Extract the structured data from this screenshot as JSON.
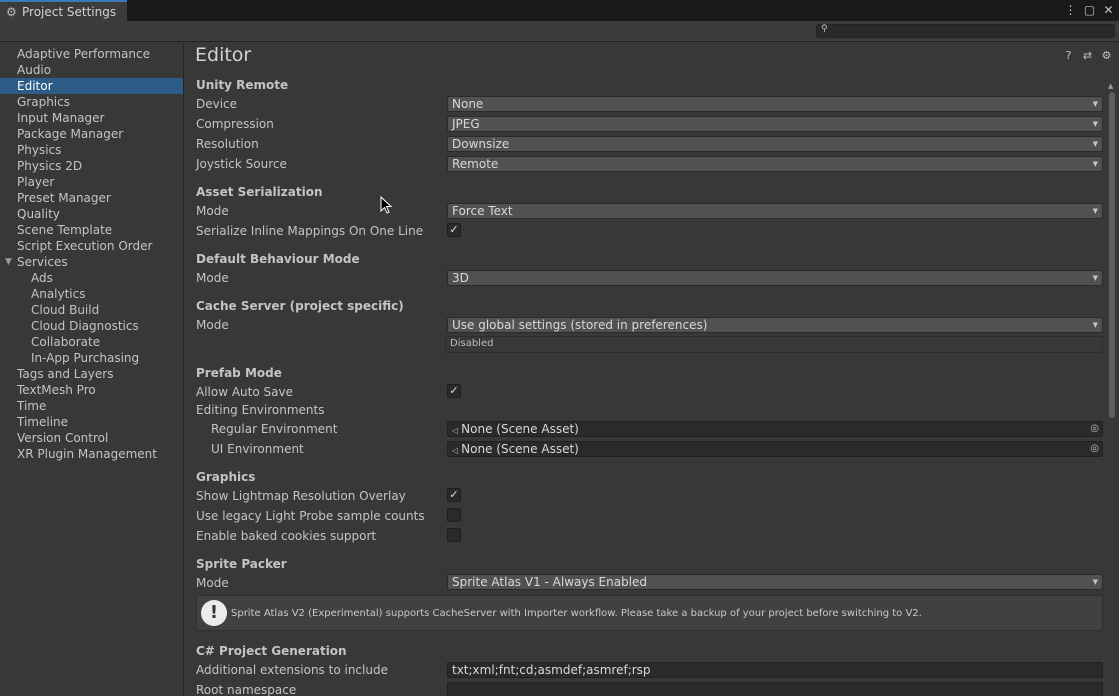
{
  "window": {
    "title": "Project Settings",
    "menu": "⋮",
    "maximize": "▢",
    "close": "✕"
  },
  "search": {
    "placeholder": ""
  },
  "sidebar": {
    "items": [
      {
        "label": "Adaptive Performance"
      },
      {
        "label": "Audio"
      },
      {
        "label": "Editor"
      },
      {
        "label": "Graphics"
      },
      {
        "label": "Input Manager"
      },
      {
        "label": "Package Manager"
      },
      {
        "label": "Physics"
      },
      {
        "label": "Physics 2D"
      },
      {
        "label": "Player"
      },
      {
        "label": "Preset Manager"
      },
      {
        "label": "Quality"
      },
      {
        "label": "Scene Template"
      },
      {
        "label": "Script Execution Order"
      },
      {
        "label": "Services"
      },
      {
        "label": "Ads"
      },
      {
        "label": "Analytics"
      },
      {
        "label": "Cloud Build"
      },
      {
        "label": "Cloud Diagnostics"
      },
      {
        "label": "Collaborate"
      },
      {
        "label": "In-App Purchasing"
      },
      {
        "label": "Tags and Layers"
      },
      {
        "label": "TextMesh Pro"
      },
      {
        "label": "Time"
      },
      {
        "label": "Timeline"
      },
      {
        "label": "Version Control"
      },
      {
        "label": "XR Plugin Management"
      }
    ],
    "selected": "Editor"
  },
  "main": {
    "title": "Editor",
    "unity_remote": {
      "header": "Unity Remote",
      "device_label": "Device",
      "device": "None",
      "compression_label": "Compression",
      "compression": "JPEG",
      "resolution_label": "Resolution",
      "resolution": "Downsize",
      "joystick_label": "Joystick Source",
      "joystick": "Remote"
    },
    "asset_serialization": {
      "header": "Asset Serialization",
      "mode_label": "Mode",
      "mode": "Force Text",
      "inline_label": "Serialize Inline Mappings On One Line",
      "inline_checked": true
    },
    "default_behaviour": {
      "header": "Default Behaviour Mode",
      "mode_label": "Mode",
      "mode": "3D"
    },
    "cache_server": {
      "header": "Cache Server (project specific)",
      "mode_label": "Mode",
      "mode": "Use global settings (stored in preferences)",
      "status": "Disabled"
    },
    "prefab_mode": {
      "header": "Prefab Mode",
      "autosave_label": "Allow Auto Save",
      "autosave_checked": true,
      "env_label": "Editing Environments",
      "regular_label": "Regular Environment",
      "regular": "None (Scene Asset)",
      "ui_label": "UI Environment",
      "ui": "None (Scene Asset)"
    },
    "graphics": {
      "header": "Graphics",
      "lightmap_label": "Show Lightmap Resolution Overlay",
      "lightmap_checked": true,
      "legacy_label": "Use legacy Light Probe sample counts",
      "legacy_checked": false,
      "cookies_label": "Enable baked cookies support",
      "cookies_checked": false
    },
    "sprite_packer": {
      "header": "Sprite Packer",
      "mode_label": "Mode",
      "mode": "Sprite Atlas V1 - Always Enabled",
      "help": "Sprite Atlas V2 (Experimental) supports CacheServer with Importer workflow. Please take a backup of your project before switching to V2."
    },
    "csharp": {
      "header": "C# Project Generation",
      "ext_label": "Additional extensions to include",
      "ext": "txt;xml;fnt;cd;asmdef;asmref;rsp",
      "ns_label": "Root namespace",
      "ns": ""
    }
  },
  "icons": {
    "check": "✓",
    "arrow": "▼",
    "help": "?",
    "presets": "⇄",
    "settings": "⚙",
    "scene": "◁",
    "picker": "◎",
    "warn": "!"
  }
}
